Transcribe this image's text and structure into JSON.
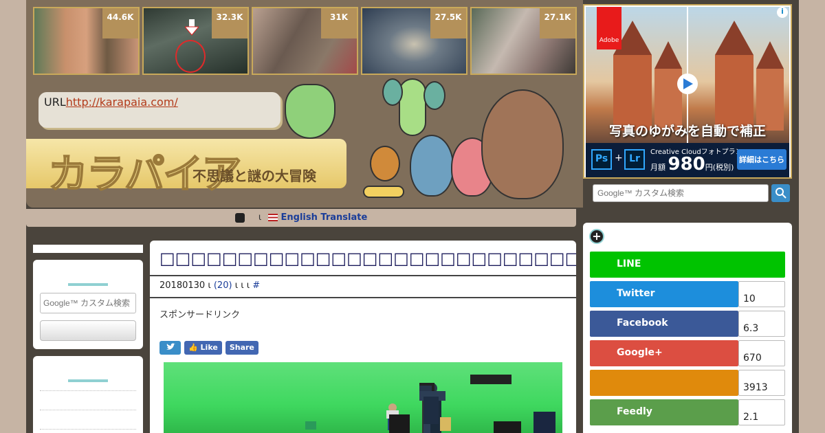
{
  "thumbnails": [
    {
      "count": "44.6K"
    },
    {
      "count": "32.3K"
    },
    {
      "count": "31K"
    },
    {
      "count": "27.5K"
    },
    {
      "count": "27.1K"
    }
  ],
  "header": {
    "url_label": "URL",
    "url_link": "http://karapaia.com/",
    "logo": "カラパイア",
    "subtitle": "不思議と謎の大冒険"
  },
  "translate": {
    "separator": "ι",
    "label": "English Translate"
  },
  "ad": {
    "brand": "Adobe",
    "headline": "写真のゆがみを自動で補正",
    "plan": "Creative Cloudフォトプラン",
    "price_prefix": "月額",
    "price": "980",
    "price_suffix": "円(税別)",
    "cta": "詳細はこちら",
    "ps": "Ps",
    "lr": "Lr",
    "plus": "+"
  },
  "search": {
    "placeholder": "Google™ カスタム検索"
  },
  "sidebar_left": {
    "search_placeholder": "Google™ カスタム検索"
  },
  "article": {
    "title": "□□□□□□□□□□□□□□□□□□□□□□□□□□□□□□□□□□□□□□□□□□",
    "date": "20180130",
    "sep": "ι",
    "comments": "(20)",
    "sep2": "ι ι ι",
    "hash": "#",
    "sponsor": "スポンサードリンク",
    "share_like": "Like",
    "share_share": "Share"
  },
  "social": {
    "plus": "+",
    "rows": [
      {
        "label": "LINE",
        "count": "",
        "color": "#00c300"
      },
      {
        "label": "Twitter",
        "count": "10",
        "color": "#1da1f2"
      },
      {
        "label": "Facebook",
        "count": "6.3",
        "color": "#3b5998"
      },
      {
        "label": "Google+",
        "count": "670",
        "color": "#dc4e41"
      },
      {
        "label": "",
        "count": "3913",
        "color": "#e08a0c"
      },
      {
        "label": "Feedly",
        "count": "2.1",
        "color": "#5b9e4b"
      }
    ]
  }
}
